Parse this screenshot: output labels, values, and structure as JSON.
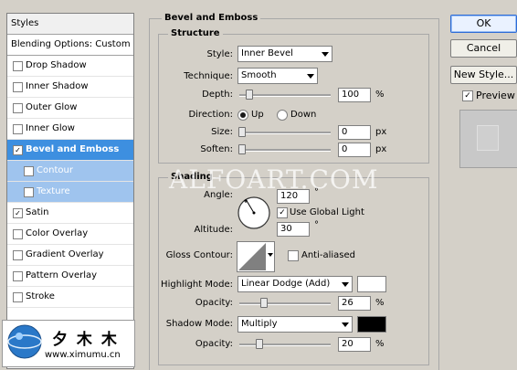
{
  "styles_panel": {
    "header": "Styles",
    "blending_options": "Blending Options: Custom",
    "items": [
      {
        "label": "Drop Shadow",
        "checked": false
      },
      {
        "label": "Inner Shadow",
        "checked": false
      },
      {
        "label": "Outer Glow",
        "checked": false
      },
      {
        "label": "Inner Glow",
        "checked": false
      },
      {
        "label": "Bevel and Emboss",
        "checked": true
      },
      {
        "label": "Contour",
        "checked": false
      },
      {
        "label": "Texture",
        "checked": false
      },
      {
        "label": "Satin",
        "checked": true
      },
      {
        "label": "Color Overlay",
        "checked": false
      },
      {
        "label": "Gradient Overlay",
        "checked": false
      },
      {
        "label": "Pattern Overlay",
        "checked": false
      },
      {
        "label": "Stroke",
        "checked": false
      }
    ]
  },
  "bevel": {
    "section_title": "Bevel and Emboss",
    "structure_title": "Structure",
    "style_label": "Style:",
    "style_value": "Inner Bevel",
    "technique_label": "Technique:",
    "technique_value": "Smooth",
    "depth_label": "Depth:",
    "depth_value": "100",
    "depth_unit": "%",
    "depth_level": 0.1,
    "direction_label": "Direction:",
    "direction_up": "Up",
    "direction_down": "Down",
    "size_label": "Size:",
    "size_value": "0",
    "size_unit": "px",
    "soften_label": "Soften:",
    "soften_value": "0",
    "soften_unit": "px"
  },
  "shading": {
    "title": "Shading",
    "angle_label": "Angle:",
    "angle_value": "120",
    "angle_unit": "°",
    "global_light_label": "Use Global Light",
    "altitude_label": "Altitude:",
    "altitude_value": "30",
    "altitude_unit": "°",
    "gloss_label": "Gloss Contour:",
    "anti_aliased_label": "Anti-aliased",
    "highlight_mode_label": "Highlight Mode:",
    "highlight_mode_value": "Linear Dodge (Add)",
    "highlight_color": "#ffffff",
    "highlight_opacity_label": "Opacity:",
    "highlight_opacity_value": "26",
    "highlight_opacity_unit": "%",
    "shadow_mode_label": "Shadow Mode:",
    "shadow_mode_value": "Multiply",
    "shadow_color": "#000000",
    "shadow_opacity_label": "Opacity:",
    "shadow_opacity_value": "20",
    "shadow_opacity_unit": "%"
  },
  "buttons": {
    "ok": "OK",
    "cancel": "Cancel",
    "new_style": "New Style...",
    "preview": "Preview"
  },
  "watermark": "ALFOART.COM",
  "logo": {
    "chinese": "夕 木 木",
    "url": "www.ximumu.cn"
  },
  "colors": {
    "selected_bg": "#3d8fe0",
    "sub_item_bg": "#9fc4ee",
    "dialog_bg": "#d4d0c8"
  }
}
